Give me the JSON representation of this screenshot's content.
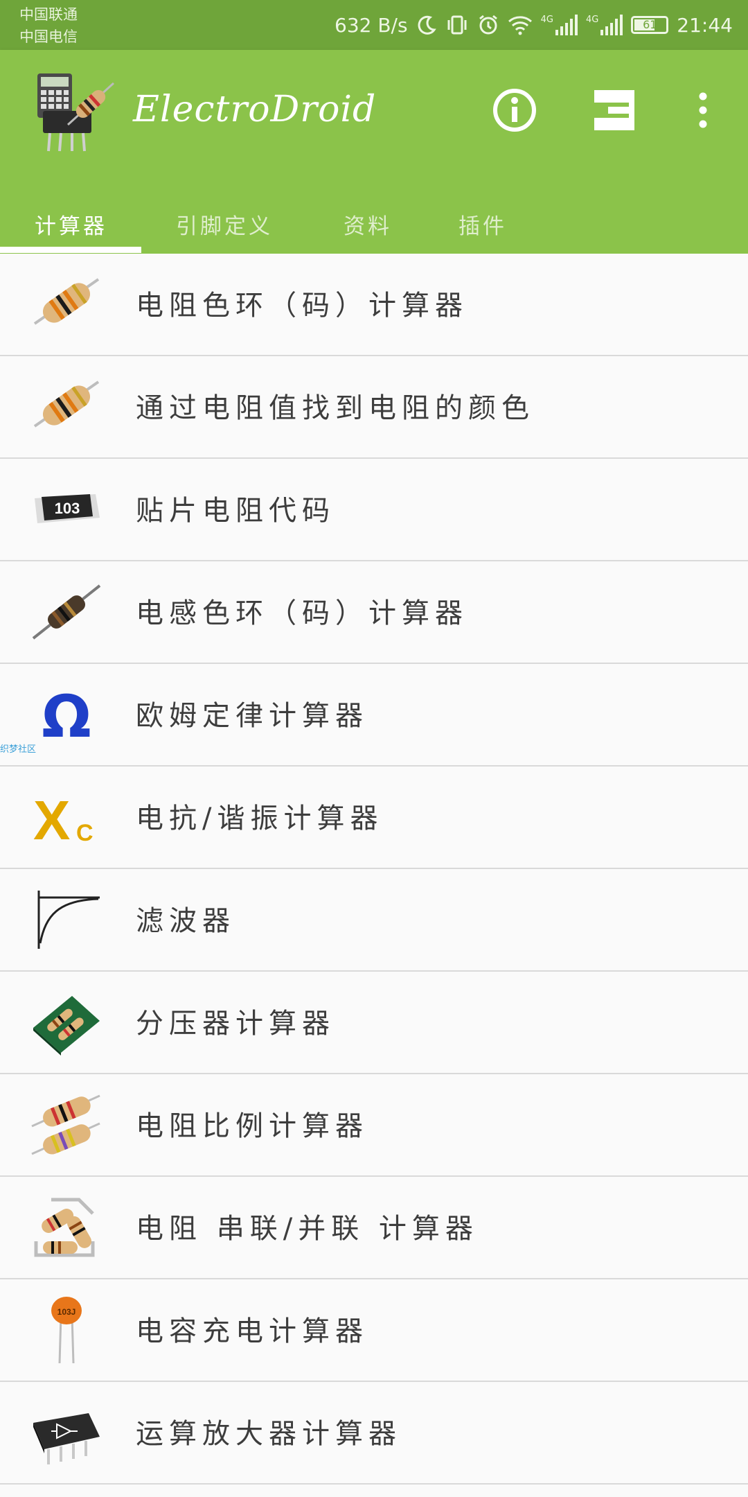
{
  "status_bar": {
    "carrier_1": "中国联通",
    "carrier_2": "中国电信",
    "network_speed": "632 B/s",
    "network_type_1": "4G",
    "network_type_2": "4G",
    "battery": "61",
    "time": "21:44"
  },
  "app_bar": {
    "title": "ElectroDroid",
    "actions": [
      "info-icon",
      "connector-icon",
      "more-vert-icon"
    ]
  },
  "tabs": [
    {
      "label": "计算器",
      "active": true
    },
    {
      "label": "引脚定义",
      "active": false
    },
    {
      "label": "资料",
      "active": false
    },
    {
      "label": "插件",
      "active": false
    }
  ],
  "items": [
    {
      "label": "电阻色环（码）计算器",
      "icon": "resistor-icon"
    },
    {
      "label": "通过电阻值找到电阻的颜色",
      "icon": "resistor-icon"
    },
    {
      "label": "贴片电阻代码",
      "icon": "smd-resistor-icon",
      "icon_text": "103"
    },
    {
      "label": "电感色环（码）计算器",
      "icon": "inductor-icon"
    },
    {
      "label": "欧姆定律计算器",
      "icon": "ohm-icon",
      "icon_text": "Ω"
    },
    {
      "label": "电抗/谐振计算器",
      "icon": "reactance-icon",
      "icon_text": "X",
      "icon_sub": "C"
    },
    {
      "label": "滤波器",
      "icon": "filter-curve-icon"
    },
    {
      "label": "分压器计算器",
      "icon": "voltage-divider-icon"
    },
    {
      "label": "电阻比例计算器",
      "icon": "resistor-pair-icon"
    },
    {
      "label": "电阻 串联/并联 计算器",
      "icon": "resistor-network-icon"
    },
    {
      "label": "电容充电计算器",
      "icon": "capacitor-icon",
      "icon_text": "103J"
    },
    {
      "label": "运算放大器计算器",
      "icon": "opamp-chip-icon"
    }
  ],
  "watermark": "织梦社区",
  "colors": {
    "status_bar": "#6fa53a",
    "app_bar": "#8bc34a",
    "list_bg": "#fafafa",
    "divider": "#d9d9d9",
    "text": "#3d3d3d"
  }
}
